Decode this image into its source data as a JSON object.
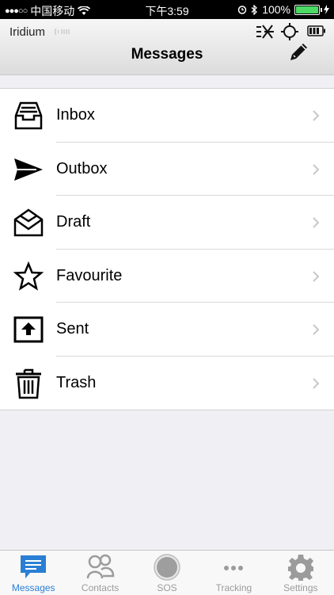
{
  "status_bar": {
    "carrier": "中国移动",
    "time": "下午3:59",
    "battery": "100%",
    "signal_dots": "●●●○○"
  },
  "nav": {
    "device_name": "Iridium",
    "title": "Messages"
  },
  "folders": [
    {
      "label": "Inbox",
      "icon": "inbox-icon"
    },
    {
      "label": "Outbox",
      "icon": "send-icon"
    },
    {
      "label": "Draft",
      "icon": "draft-envelope-icon"
    },
    {
      "label": "Favourite",
      "icon": "star-icon"
    },
    {
      "label": "Sent",
      "icon": "sent-upload-icon"
    },
    {
      "label": "Trash",
      "icon": "trash-icon"
    }
  ],
  "tabs": [
    {
      "label": "Messages",
      "icon": "chat-bubble-icon",
      "active": true
    },
    {
      "label": "Contacts",
      "icon": "contacts-icon",
      "active": false
    },
    {
      "label": "SOS",
      "icon": "sos-icon",
      "active": false
    },
    {
      "label": "Tracking",
      "icon": "tracking-icon",
      "active": false
    },
    {
      "label": "Settings",
      "icon": "gear-icon",
      "active": false
    }
  ],
  "colors": {
    "accent": "#2a7fd4",
    "battery_green": "#4cd964",
    "inactive_tab": "#9b9b9b"
  }
}
